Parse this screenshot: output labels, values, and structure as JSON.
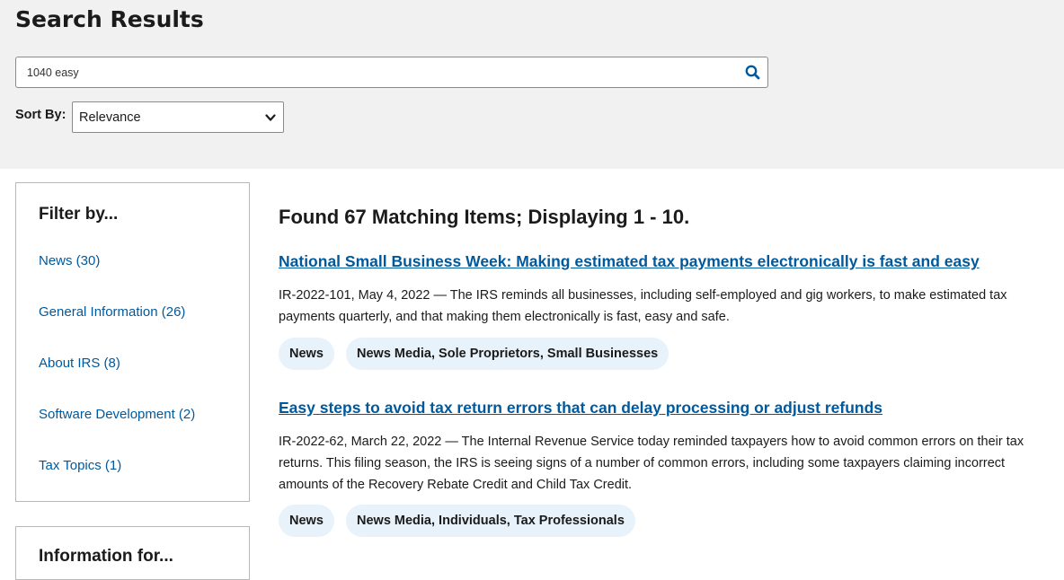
{
  "page": {
    "title": "Search Results"
  },
  "search": {
    "value": "1040 easy",
    "button_icon": "search-icon"
  },
  "sort": {
    "label": "Sort By:",
    "selected": "Relevance",
    "chevron_icon": "chevron-down-icon"
  },
  "filter": {
    "title": "Filter by...",
    "items": [
      {
        "label": "News (30)"
      },
      {
        "label": "General Information (26)"
      },
      {
        "label": "About IRS (8)"
      },
      {
        "label": "Software Development (2)"
      },
      {
        "label": "Tax Topics (1)"
      }
    ]
  },
  "info_for": {
    "title": "Information for..."
  },
  "results": {
    "heading": "Found 67 Matching Items; Displaying 1 - 10.",
    "items": [
      {
        "title": "National Small Business Week: Making estimated tax payments electronically is fast and easy",
        "description": "IR-2022-101, May 4, 2022 — The IRS reminds all businesses, including self-employed and gig workers, to make estimated tax payments quarterly, and that making them electronically is fast, easy and safe.",
        "tags": [
          "News",
          "News Media, Sole Proprietors, Small Businesses"
        ]
      },
      {
        "title": "Easy steps to avoid tax return errors that can delay processing or adjust refunds",
        "description": "IR-2022-62, March 22, 2022 — The Internal Revenue Service today reminded taxpayers how to avoid common errors on their tax returns. This filing season, the IRS is seeing signs of a number of common errors, including some taxpayers claiming incorrect amounts of the Recovery Rebate Credit and Child Tax Credit.",
        "tags": [
          "News",
          "News Media, Individuals, Tax Professionals"
        ]
      }
    ]
  },
  "colors": {
    "link": "#00599c",
    "header_bg": "#f1f1f1",
    "tag_bg": "#e7f2fa",
    "text": "#1b1b1b"
  }
}
